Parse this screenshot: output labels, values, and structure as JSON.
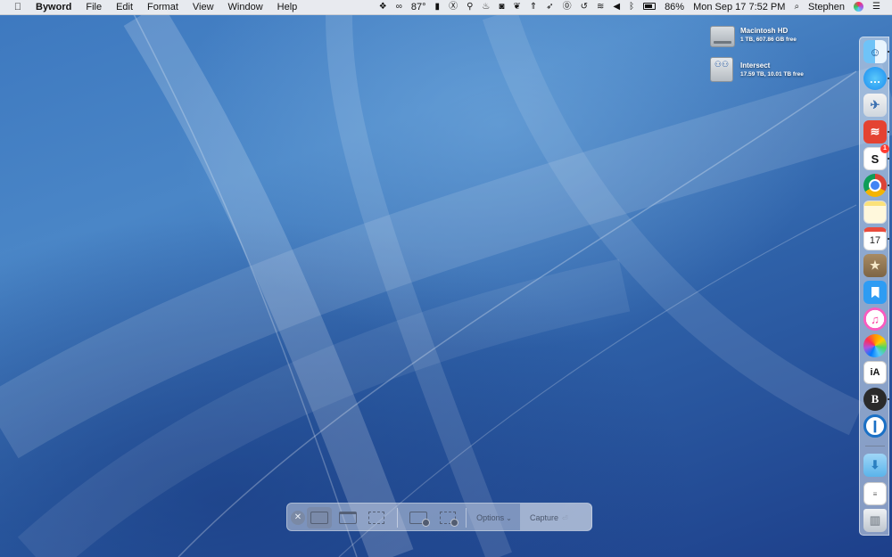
{
  "menubar": {
    "app_name": "Byword",
    "menus": [
      "File",
      "Edit",
      "Format",
      "View",
      "Window",
      "Help"
    ],
    "temperature": "87°",
    "battery_percent": "86%",
    "datetime": "Mon Sep 17  7:52 PM",
    "user": "Stephen"
  },
  "desktop": {
    "drives": [
      {
        "name": "Macintosh HD",
        "info": "1 TB, 607.86 GB free"
      },
      {
        "name": "Intersect",
        "info": "17.59 TB, 10.01 TB free"
      }
    ]
  },
  "dock": {
    "apps": [
      "finder",
      "messages",
      "preview",
      "todoist",
      "slack",
      "chrome",
      "notes",
      "calendar",
      "deliveries",
      "day-one",
      "itunes",
      "photos",
      "ia-writer",
      "bear",
      "1password"
    ],
    "calendar_day": "17",
    "slack_badge": "1",
    "ia_label": "iA",
    "bear_label": "B",
    "slack_label": "S"
  },
  "screenshot_toolbar": {
    "options_label": "Options",
    "capture_label": "Capture",
    "capture_hint": "⏎"
  },
  "colors": {
    "desktop_top": "#4a86c7",
    "desktop_bottom": "#1d3f8a"
  }
}
